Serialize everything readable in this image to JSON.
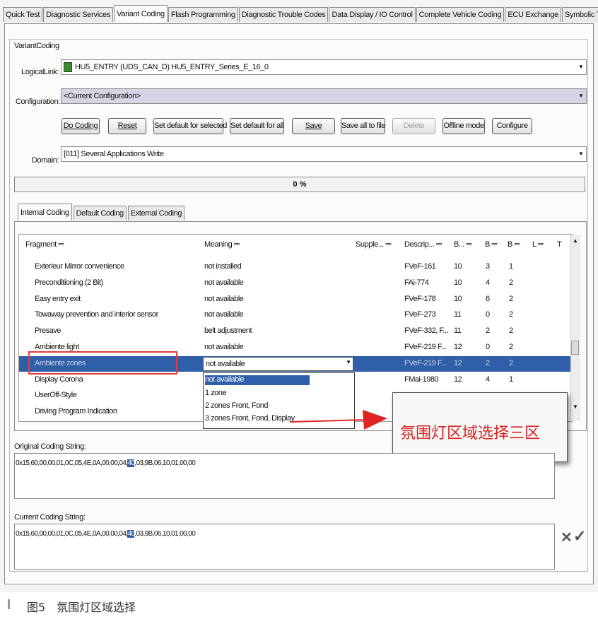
{
  "tabs": [
    "Quick Test",
    "Diagnostic Services",
    "Variant Coding",
    "Flash Programming",
    "Diagnostic Trouble Codes",
    "Data Display / IO Control",
    "Complete Vehicle Coding",
    "ECU Exchange",
    "Symbolic Trace"
  ],
  "active_tab": "Variant Coding",
  "group_title": "VariantCoding",
  "logical_link": {
    "label": "LogicalLink:",
    "value": "HU5_ENTRY (UDS_CAN_D) HU5_ENTRY_Series_E_16_0"
  },
  "configuration": {
    "label": "Configuration:",
    "value": "<Current Configuration>"
  },
  "buttons": {
    "do_coding": "Do Coding",
    "reset": "Reset",
    "set_default_selected": "Set default for selected",
    "set_default_all": "Set default for all",
    "save": "Save",
    "save_all_to_file": "Save all to file",
    "delete": "Delete",
    "offline_mode": "Offline mode",
    "configure": "Configure"
  },
  "domain": {
    "label": "Domain:",
    "value": "[011] Several Applications Write"
  },
  "progress": {
    "value": 0,
    "text": "0 %"
  },
  "subtabs": [
    "Internal Coding",
    "Default Coding",
    "External Coding"
  ],
  "columns": [
    "Fragment",
    "Meaning",
    "Supple...",
    "Descrip...",
    "B...",
    "B",
    "B",
    "L",
    "T"
  ],
  "rows": [
    {
      "fragment": "Exterieur Mirror convenience",
      "meaning": "not installed",
      "desc": "FVeF-161",
      "b1": "10",
      "b2": "3",
      "b3": "1"
    },
    {
      "fragment": "Preconditioning (2 Bit)",
      "meaning": "not available",
      "desc": "FAi-774",
      "b1": "10",
      "b2": "4",
      "b3": "2"
    },
    {
      "fragment": "Easy entry exit",
      "meaning": "not available",
      "desc": "FVeF-178",
      "b1": "10",
      "b2": "6",
      "b3": "2"
    },
    {
      "fragment": "Towaway prevention and interior sensor",
      "meaning": "not available",
      "desc": "FVeF-273",
      "b1": "11",
      "b2": "0",
      "b3": "2"
    },
    {
      "fragment": "Presave",
      "meaning": "belt adjustment",
      "desc": "FVeF-332, F...",
      "b1": "11",
      "b2": "2",
      "b3": "2"
    },
    {
      "fragment": "Ambiente light",
      "meaning": "not available",
      "desc": "FVeF-219 F...",
      "b1": "12",
      "b2": "0",
      "b3": "2"
    },
    {
      "fragment": "Ambiente zones",
      "meaning": "not available",
      "desc": "FVeF-219 F...",
      "b1": "12",
      "b2": "2",
      "b3": "2",
      "selected": true
    },
    {
      "fragment": "Display Corona",
      "meaning": "",
      "desc": "FMai-1980",
      "b1": "12",
      "b2": "4",
      "b3": "1"
    },
    {
      "fragment": "UserOff-Style",
      "meaning": "",
      "desc": "",
      "b1": "",
      "b2": "",
      "b3": ""
    },
    {
      "fragment": "Driving Program Indication",
      "meaning": "",
      "desc": "",
      "b1": "",
      "b2": "",
      "b3": ""
    }
  ],
  "dropdown_options": [
    "not available",
    "1 zone",
    "2 zones Front, Fond",
    "3 zones Front, Fond, Display"
  ],
  "annotation": "氛围灯区域选择三区",
  "original_coding": {
    "label": "Original Coding String:",
    "prefix": "0x15,60,00,00,01,0C,05,4E,0A,00,00,04,",
    "highlight": "40",
    "suffix": ",03,9B,06,10,01,00,00"
  },
  "current_coding": {
    "label": "Current Coding String:",
    "prefix": "0x15,60,00,00,01,0C,05,4E,0A,00,00,04,",
    "highlight": "40",
    "suffix": ",03,9B,06,10,01,00,00"
  },
  "caption": "图5　氛围灯区域选择"
}
